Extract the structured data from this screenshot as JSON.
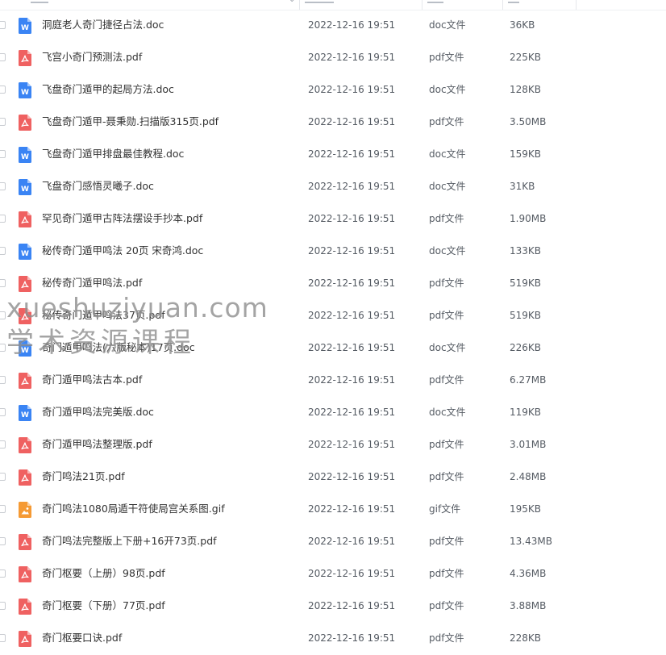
{
  "columns": {
    "sort_indicator": "⌄"
  },
  "icon_types": {
    "doc": {
      "icon": "word-doc-icon",
      "color": "#3a84f4",
      "glyph": "W"
    },
    "pdf": {
      "icon": "pdf-file-icon",
      "color": "#ef6161",
      "glyph": ""
    },
    "gif": {
      "icon": "image-file-icon",
      "color": "#f59a34",
      "glyph": ""
    }
  },
  "files": [
    {
      "name": "洞庭老人奇门捷径占法.doc",
      "date": "2022-12-16 19:51",
      "type": "doc文件",
      "size": "36KB",
      "kind": "doc"
    },
    {
      "name": "飞宫小奇门预测法.pdf",
      "date": "2022-12-16 19:51",
      "type": "pdf文件",
      "size": "225KB",
      "kind": "pdf"
    },
    {
      "name": "飞盘奇门遁甲的起局方法.doc",
      "date": "2022-12-16 19:51",
      "type": "doc文件",
      "size": "128KB",
      "kind": "doc"
    },
    {
      "name": "飞盘奇门遁甲-聂秉勋.扫描版315页.pdf",
      "date": "2022-12-16 19:51",
      "type": "pdf文件",
      "size": "3.50MB",
      "kind": "pdf"
    },
    {
      "name": "飞盘奇门遁甲排盘最佳教程.doc",
      "date": "2022-12-16 19:51",
      "type": "doc文件",
      "size": "159KB",
      "kind": "doc"
    },
    {
      "name": "飞盘奇门感悟灵曦子.doc",
      "date": "2022-12-16 19:51",
      "type": "doc文件",
      "size": "31KB",
      "kind": "doc"
    },
    {
      "name": "罕见奇门遁甲古阵法摆设手抄本.pdf",
      "date": "2022-12-16 19:51",
      "type": "pdf文件",
      "size": "1.90MB",
      "kind": "pdf"
    },
    {
      "name": "秘传奇门遁甲鸣法 20页 宋奇鸿.doc",
      "date": "2022-12-16 19:51",
      "type": "doc文件",
      "size": "133KB",
      "kind": "doc"
    },
    {
      "name": "秘传奇门遁甲鸣法.pdf",
      "date": "2022-12-16 19:51",
      "type": "pdf文件",
      "size": "519KB",
      "kind": "pdf"
    },
    {
      "name": "秘传奇门遁甲鸣法37页.pdf",
      "date": "2022-12-16 19:51",
      "type": "pdf文件",
      "size": "519KB",
      "kind": "pdf"
    },
    {
      "name": "奇门遁甲鸣法(六版秘本)17页.doc",
      "date": "2022-12-16 19:51",
      "type": "doc文件",
      "size": "226KB",
      "kind": "doc"
    },
    {
      "name": "奇门遁甲鸣法古本.pdf",
      "date": "2022-12-16 19:51",
      "type": "pdf文件",
      "size": "6.27MB",
      "kind": "pdf"
    },
    {
      "name": "奇门遁甲鸣法完美版.doc",
      "date": "2022-12-16 19:51",
      "type": "doc文件",
      "size": "119KB",
      "kind": "doc"
    },
    {
      "name": "奇门遁甲鸣法整理版.pdf",
      "date": "2022-12-16 19:51",
      "type": "pdf文件",
      "size": "3.01MB",
      "kind": "pdf"
    },
    {
      "name": "奇门鸣法21页.pdf",
      "date": "2022-12-16 19:51",
      "type": "pdf文件",
      "size": "2.48MB",
      "kind": "pdf"
    },
    {
      "name": "奇门鸣法1080局遁干符使局宫关系图.gif",
      "date": "2022-12-16 19:51",
      "type": "gif文件",
      "size": "195KB",
      "kind": "gif"
    },
    {
      "name": "奇门鸣法完整版上下册+16开73页.pdf",
      "date": "2022-12-16 19:51",
      "type": "pdf文件",
      "size": "13.43MB",
      "kind": "pdf"
    },
    {
      "name": "奇门枢要（上册）98页.pdf",
      "date": "2022-12-16 19:51",
      "type": "pdf文件",
      "size": "4.36MB",
      "kind": "pdf"
    },
    {
      "name": "奇门枢要（下册）77页.pdf",
      "date": "2022-12-16 19:51",
      "type": "pdf文件",
      "size": "3.88MB",
      "kind": "pdf"
    },
    {
      "name": "奇门枢要口诀.pdf",
      "date": "2022-12-16 19:51",
      "type": "pdf文件",
      "size": "228KB",
      "kind": "pdf"
    }
  ],
  "watermark": {
    "line1": "xueshuziyuan.com",
    "line2": "学术资源课程"
  }
}
